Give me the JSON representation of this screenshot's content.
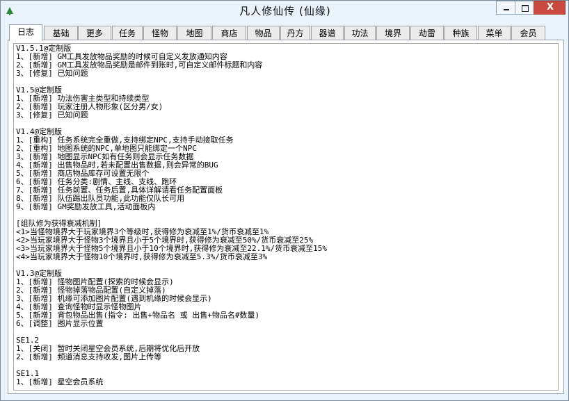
{
  "window": {
    "title": "凡人修仙传 (仙缘)",
    "close_label": "X"
  },
  "tabs": [
    "日志",
    "基础",
    "更多",
    "任务",
    "怪物",
    "地图",
    "商店",
    "物品",
    "丹方",
    "器谱",
    "功法",
    "境界",
    "劫雷",
    "种族",
    "菜单",
    "会员"
  ],
  "active_tab": 0,
  "log": [
    "V1.5.1@定制版",
    "1、[新增] GM工具发放物品奖励的时候可自定义发放通知内容",
    "2、[新增] GM工具发放物品奖励是邮件到账时,可自定义邮件标题和内容",
    "3、[修复] 已知问题",
    "",
    "V1.5@定制版",
    "1、[新增] 功法伤害主类型和持续类型",
    "2、[新增] 玩家注册人物形象(区分男/女)",
    "3、[修复] 已知问题",
    "",
    "V1.4@定制版",
    "1、[重构] 任务系统完全重做,支持绑定NPC,支持手动接取任务",
    "2、[重构] 地图系统的NPC,单地图只能绑定一个NPC",
    "3、[新增] 地图显示NPC如有任务则会显示任务数据",
    "4、[新增] 出售物品时,若未配置出售数据,则会异常的BUG",
    "5、[新增] 商店物品库存可设置无限个",
    "6、[新增] 任务分类:剧情、主线、支线、跑环",
    "7、[新增] 任务前置、任务后置,具体详解请看任务配置面板",
    "8、[新增] 队伍踢出队员功能,此功能仅队长可用",
    "9、[新增] GM奖励发放工具,活动面板内",
    "",
    "[组队修为获得衰减机制]",
    "<1>当怪物境界大于玩家境界3个等级时,获得修为衰减至1%/货币衰减至1%",
    "<2>当玩家境界大于怪物3个境界且小于5个境界时,获得修为衰减至50%/货币衰减至25%",
    "<3>当玩家境界大于怪物5个境界且小于10个境界时,获得修为衰减至22.1%/货币衰减至15%",
    "<4>当玩家境界大于怪物10个境界时,获得修为衰减至5.3%/货币衰减至3%",
    "",
    "V1.3@定制版",
    "1、[新增] 怪物图片配置(探索的时候会显示)",
    "2、[新增] 怪物掉落物品配置(自定义掉落)",
    "3、[新增] 机缘可添加图片配置(遇到机缘的时候会显示)",
    "4、[新增] 查询怪物时显示怪物图片",
    "5、[新增] 背包物品出售(指令: 出售+物品名 或 出售+物品名#数量)",
    "6、[调整] 图片显示位置",
    "",
    "SE1.2",
    "1、[关闭] 暂时关闭星空会员系统,后期将优化后开放",
    "2、[新增] 频道消息支持收发,图片上传等",
    "",
    "SE1.1",
    "1、[新增] 星空会员系统"
  ]
}
